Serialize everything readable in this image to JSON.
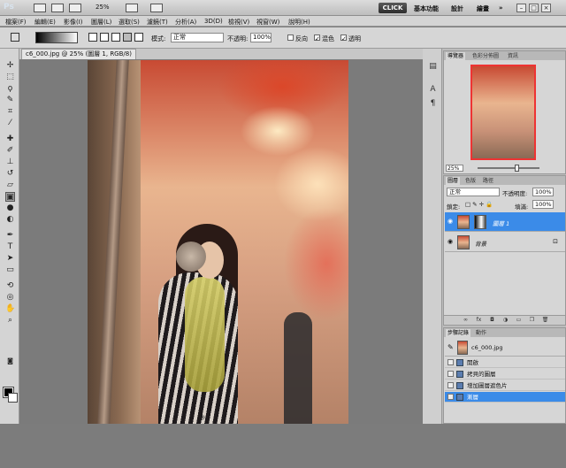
{
  "app": {
    "logo": "Ps",
    "zoom": "25%",
    "click_label": "CLICK",
    "workspaces": [
      "基本功能",
      "設計",
      "繪畫"
    ],
    "more": "»"
  },
  "menu": [
    "檔案(F)",
    "編輯(E)",
    "影像(I)",
    "圖層(L)",
    "選取(S)",
    "濾鏡(T)",
    "分析(A)",
    "3D(D)",
    "檢視(V)",
    "視窗(W)",
    "說明(H)"
  ],
  "options": {
    "mode_label": "模式:",
    "mode_value": "正常",
    "opacity_label": "不透明:",
    "opacity_value": "100%",
    "reverse_label": "反向",
    "dither_label": "混色",
    "transparency_label": "透明"
  },
  "document": {
    "tab_title": "c6_000.jpg @ 25% (圖層 1, RGB/8)"
  },
  "navigator": {
    "tabs": [
      "導覽器",
      "色彩分佈圖",
      "資訊"
    ],
    "zoom": "25%"
  },
  "layers": {
    "tabs": [
      "圖層",
      "色版",
      "路徑"
    ],
    "blend_mode": "正常",
    "opacity_label": "不透明度:",
    "opacity_value": "100%",
    "lock_label": "鎖定:",
    "fill_label": "填滿:",
    "fill_value": "100%",
    "items": [
      {
        "name": "圖層 1",
        "selected": true
      },
      {
        "name": "背景",
        "selected": false
      }
    ]
  },
  "history": {
    "tabs": [
      "步驟記錄",
      "動作"
    ],
    "snapshot": "c6_000.jpg",
    "items": [
      {
        "label": "開啟",
        "selected": false
      },
      {
        "label": "拷貝的圖層",
        "selected": false
      },
      {
        "label": "增加圖層遮色片",
        "selected": false
      },
      {
        "label": "漸層",
        "selected": true
      }
    ]
  },
  "colors": {
    "selection": "#3b8be8",
    "foreground": "#000000",
    "background": "#ffffff"
  }
}
